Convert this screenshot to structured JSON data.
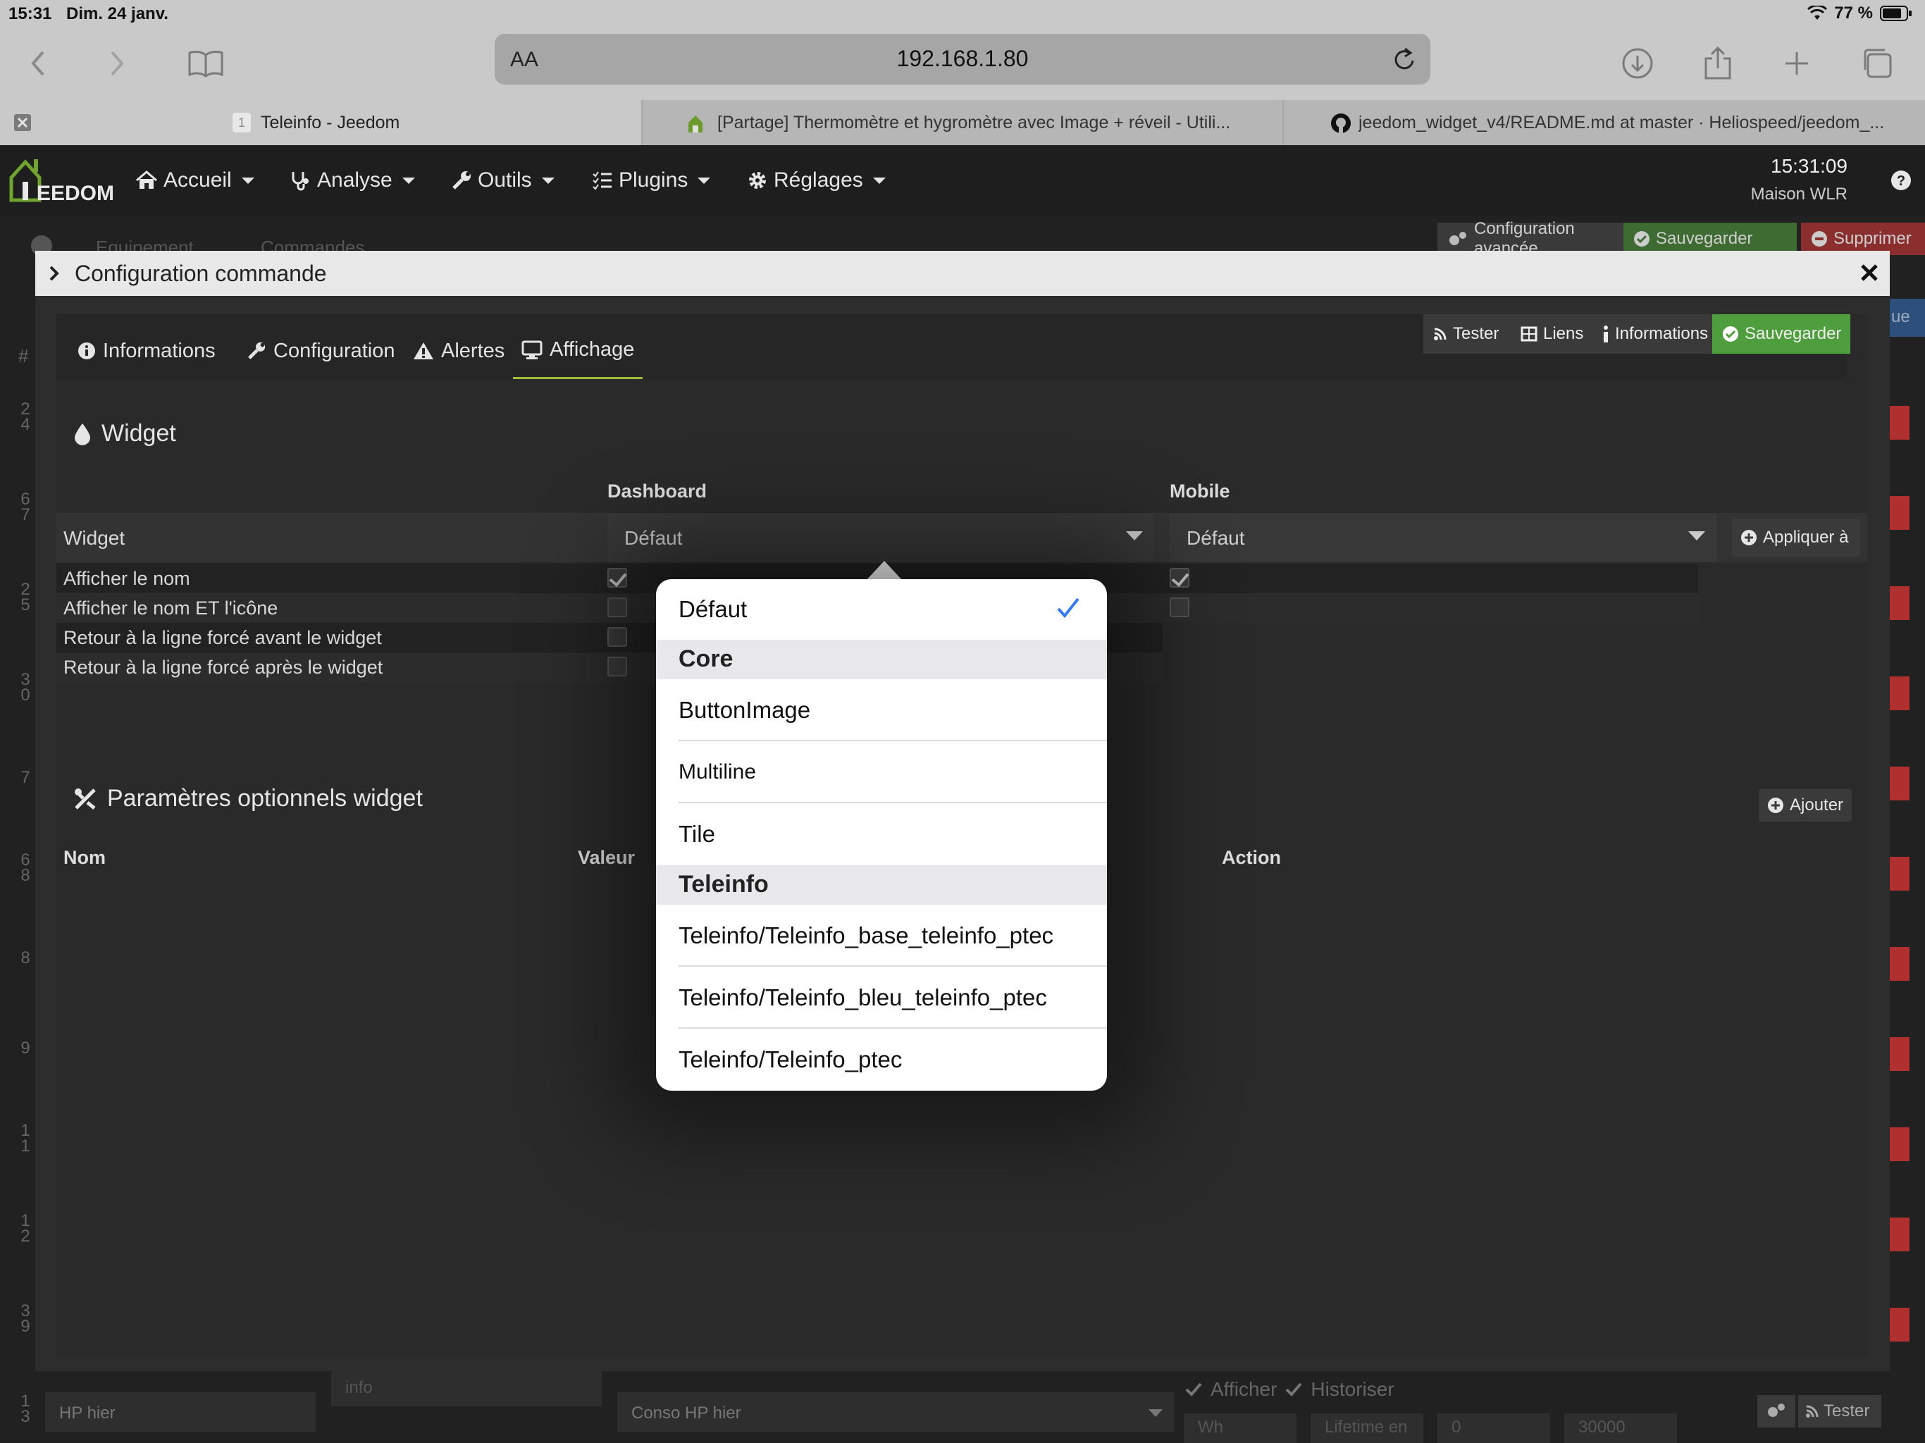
{
  "status_bar": {
    "time": "15:31",
    "date": "Dim. 24 janv.",
    "battery": "77 %"
  },
  "safari": {
    "aa": "AA",
    "url": "192.168.1.80",
    "tabs": [
      {
        "badge": "1",
        "title": "Teleinfo - Jeedom"
      },
      {
        "title": "[Partage] Thermomètre et hygromètre avec Image + réveil - Utili..."
      },
      {
        "title": "jeedom_widget_v4/README.md at master · Heliospeed/jeedom_..."
      }
    ]
  },
  "navbar": {
    "logo": "EEDOM",
    "menu": [
      "Accueil",
      "Analyse",
      "Outils",
      "Plugins",
      "Réglages"
    ],
    "clock": "15:31:09",
    "home_name": "Maison WLR"
  },
  "background_page": {
    "tabs": [
      "Equipement",
      "Commandes"
    ],
    "buttons": {
      "advanced": "Configuration avancée",
      "save": "Sauvegarder",
      "delete": "Supprimer"
    },
    "hash": "#",
    "row_numbers": [
      "2\n4",
      "6\n7",
      "2\n5",
      "3\n0",
      "7",
      "6\n8",
      "8",
      "9",
      "1\n1",
      "1\n2",
      "3\n9",
      "1\n3"
    ],
    "bottom": {
      "name": "HP hier",
      "type": "info",
      "label": "Conso HP hier",
      "afficher": "Afficher",
      "historiser": "Historiser",
      "unit": "Wh",
      "lifetime": "Lifetime en",
      "min": "0",
      "max": "30000",
      "tester": "Tester",
      "edge_label": "ue"
    }
  },
  "modal": {
    "title": "Configuration commande",
    "tabs": [
      "Informations",
      "Configuration",
      "Alertes",
      "Affichage"
    ],
    "actions": {
      "test": "Tester",
      "links": "Liens",
      "info": "Informations",
      "save": "Sauvegarder"
    },
    "widget_section": {
      "title": "Widget",
      "col_dashboard": "Dashboard",
      "col_mobile": "Mobile",
      "row_label": "Widget",
      "dashboard_value": "Défaut",
      "mobile_value": "Défaut",
      "apply_button": "Appliquer à",
      "options": [
        {
          "label": "Afficher le nom",
          "dashboard": true,
          "mobile": true
        },
        {
          "label": "Afficher le nom ET l'icône",
          "dashboard": false,
          "mobile": false
        },
        {
          "label": "Retour à la ligne forcé avant le widget",
          "dashboard": false
        },
        {
          "label": "Retour à la ligne forcé après le widget",
          "dashboard": false
        }
      ]
    },
    "params_section": {
      "title": "Paramètres optionnels widget",
      "add_button": "Ajouter",
      "col_name": "Nom",
      "col_value": "Valeur",
      "col_action": "Action"
    }
  },
  "popover": {
    "selected": "Défaut",
    "groups": [
      {
        "items": [
          "Défaut"
        ]
      },
      {
        "name": "Core",
        "items": [
          "ButtonImage",
          "Multiline",
          "Tile"
        ]
      },
      {
        "name": "Teleinfo",
        "items": [
          "Teleinfo/Teleinfo_base_teleinfo_ptec",
          "Teleinfo/Teleinfo_bleu_teleinfo_ptec",
          "Teleinfo/Teleinfo_ptec"
        ]
      }
    ]
  },
  "colors": {
    "accent_green": "#4f9e3e",
    "check_blue": "#2f7cf6",
    "danger_red": "#b03030",
    "tab_underline": "#9fbf3a"
  }
}
